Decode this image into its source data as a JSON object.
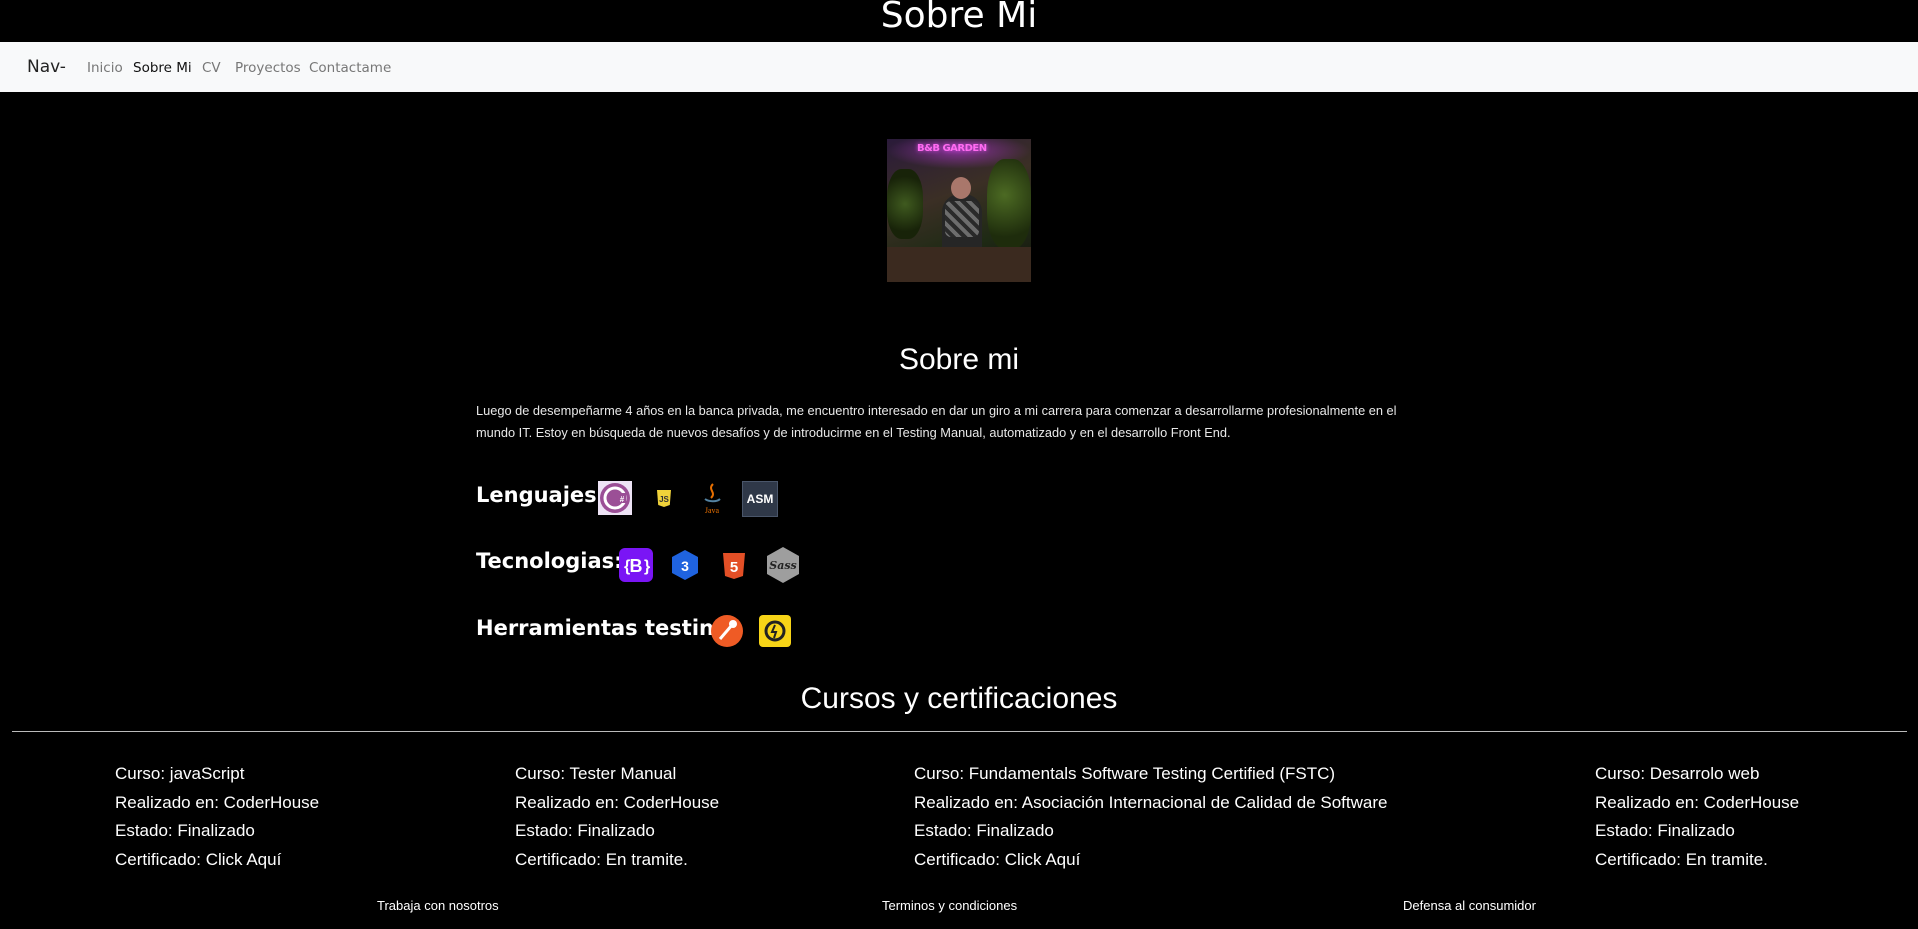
{
  "header": {
    "title": "Sobre Mi"
  },
  "navbar": {
    "brand": "Nav-",
    "links": [
      "Inicio",
      "Sobre Mi",
      "CV",
      "Proyectos",
      "Contactame"
    ],
    "active": "Sobre Mi"
  },
  "profile": {
    "photo_sign": "B&B GARDEN"
  },
  "about": {
    "title": "Sobre mi",
    "line1": "Luego de desempeñarme 4 años en la banca privada, me encuentro interesado en dar un giro a mi carrera para comenzar a desarrollarme profesionalmente en el",
    "line2": "mundo IT. Estoy en búsqueda de nuevos desafíos y de introducirme en el Testing Manual, automatizado y en el desarrollo Front End."
  },
  "skills": {
    "languages": {
      "label": "Lenguajes:",
      "icons": [
        "csharp-icon",
        "javascript-icon",
        "java-icon",
        "asm-icon"
      ],
      "asm_text": "ASM",
      "java_text": "Java"
    },
    "technologies": {
      "label": "Tecnologias:",
      "icons": [
        "bootstrap-icon",
        "css3-icon",
        "html5-icon",
        "sass-icon"
      ],
      "sass_text": "Sass"
    },
    "testing_tools": {
      "label": "Herramientas testing",
      "icons": [
        "postman-icon",
        "testing-tool-icon"
      ]
    }
  },
  "courses": {
    "title": "Cursos y certificaciones",
    "items": [
      {
        "curso": "Curso: javaScript",
        "realizado": "Realizado en: CoderHouse",
        "estado": "Estado: Finalizado",
        "certificado": "Certificado: Click Aquí"
      },
      {
        "curso": "Curso: Tester Manual",
        "realizado": "Realizado en: CoderHouse",
        "estado": "Estado: Finalizado",
        "certificado": "Certificado: En tramite."
      },
      {
        "curso": "Curso: Fundamentals Software Testing Certified (FSTC)",
        "realizado": "Realizado en: Asociación Internacional de Calidad de Software",
        "estado": "Estado: Finalizado",
        "certificado": "Certificado: Click Aquí"
      },
      {
        "curso": "Curso: Desarrolo web",
        "realizado": "Realizado en: CoderHouse",
        "estado": "Estado: Finalizado",
        "certificado": "Certificado: En tramite."
      }
    ]
  },
  "footer": {
    "links": [
      "Trabaja con nosotros",
      "Terminos y condiciones",
      "Defensa al consumidor"
    ]
  },
  "colors": {
    "navbar_bg": "#f8f9fa",
    "page_bg": "#000000",
    "bootstrap": "#7a15f5",
    "css3": "#1f63df",
    "html5": "#e34f26",
    "postman": "#ef5b25",
    "js": "#f0d23a"
  }
}
